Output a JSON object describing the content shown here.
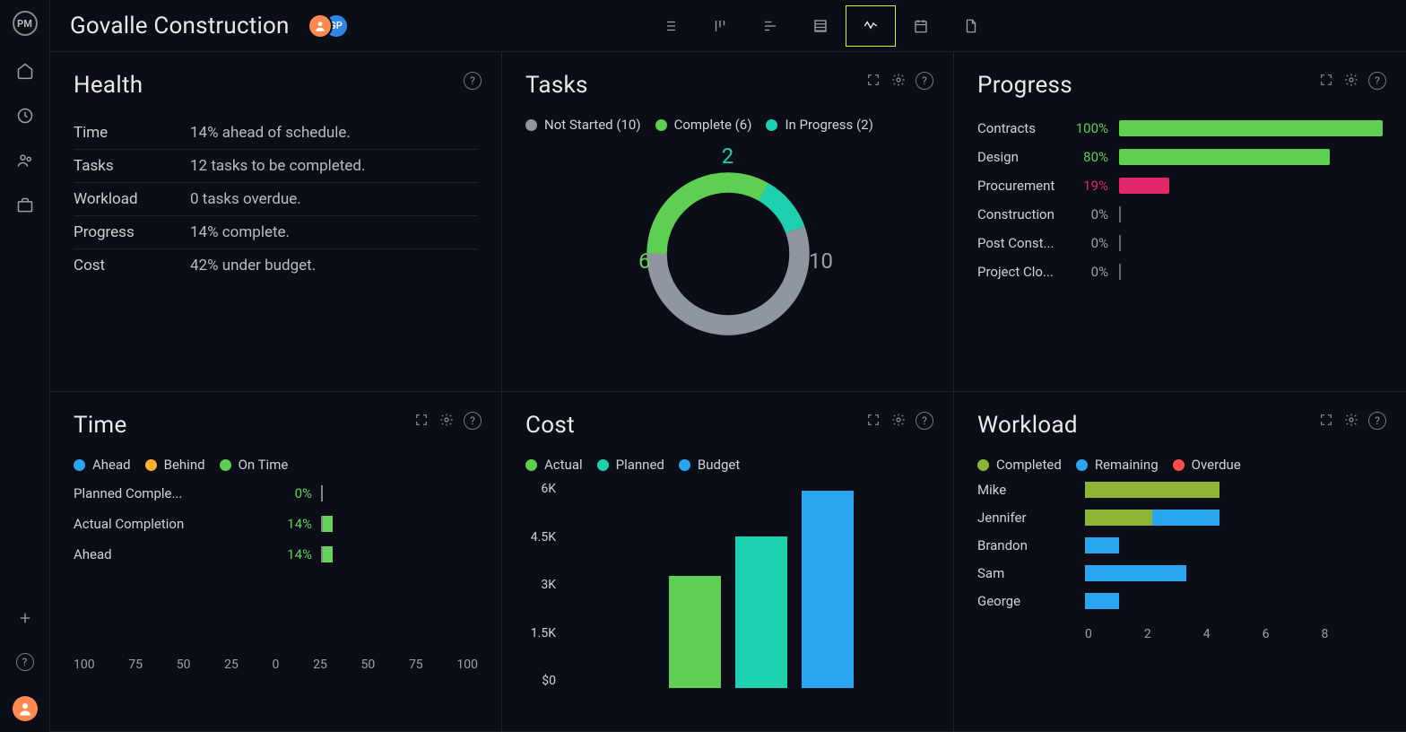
{
  "header": {
    "project_title": "Govalle Construction",
    "badge2_initials": "GP"
  },
  "colors": {
    "green": "#5fcf53",
    "teal": "#1dd1b0",
    "gray": "#8f96a1",
    "blue": "#2aa5ef",
    "olive": "#8db437",
    "pink": "#e2286b",
    "orange": "#ffb02e",
    "red": "#ff4c4c"
  },
  "panels": {
    "health": {
      "title": "Health",
      "rows": [
        {
          "label": "Time",
          "value": "14% ahead of schedule."
        },
        {
          "label": "Tasks",
          "value": "12 tasks to be completed."
        },
        {
          "label": "Workload",
          "value": "0 tasks overdue."
        },
        {
          "label": "Progress",
          "value": "14% complete."
        },
        {
          "label": "Cost",
          "value": "42% under budget."
        }
      ]
    },
    "tasks": {
      "title": "Tasks",
      "legend": [
        {
          "label": "Not Started (10)",
          "color": "#8f96a1",
          "icon": "dot-gray"
        },
        {
          "label": "Complete (6)",
          "color": "#5fcf53",
          "icon": "dot-green"
        },
        {
          "label": "In Progress (2)",
          "color": "#1dd1b0",
          "icon": "dot-teal"
        }
      ],
      "chart_data": {
        "type": "pie",
        "title": "Tasks",
        "categories": [
          "Not Started",
          "Complete",
          "In Progress"
        ],
        "values": [
          10,
          6,
          2
        ],
        "colors": [
          "#8f96a1",
          "#5fcf53",
          "#1dd1b0"
        ]
      },
      "labels": {
        "top": "2",
        "left": "6",
        "right": "10"
      }
    },
    "progress": {
      "title": "Progress",
      "chart_data": {
        "type": "bar",
        "orientation": "horizontal",
        "xlim": [
          0,
          100
        ],
        "categories": [
          "Contracts",
          "Design",
          "Procurement",
          "Construction",
          "Post Const...",
          "Project Clo..."
        ],
        "values": [
          100,
          80,
          19,
          0,
          0,
          0
        ],
        "colors": [
          "#5fcf53",
          "#5fcf53",
          "#e2286b",
          null,
          null,
          null
        ]
      }
    },
    "time": {
      "title": "Time",
      "legend": [
        {
          "label": "Ahead",
          "color": "#2aa5ef"
        },
        {
          "label": "Behind",
          "color": "#ffb02e"
        },
        {
          "label": "On Time",
          "color": "#5fcf53"
        }
      ],
      "chart_data": {
        "type": "bar",
        "orientation": "horizontal",
        "xlim": [
          -100,
          100
        ],
        "xticks": [
          100,
          75,
          50,
          25,
          0,
          25,
          50,
          75,
          100
        ],
        "series": [
          {
            "name": "Planned Comple...",
            "value": 0,
            "display": "0%"
          },
          {
            "name": "Actual Completion",
            "value": 14,
            "display": "14%"
          },
          {
            "name": "Ahead",
            "value": 14,
            "display": "14%"
          }
        ]
      }
    },
    "cost": {
      "title": "Cost",
      "legend": [
        {
          "label": "Actual",
          "color": "#5fcf53"
        },
        {
          "label": "Planned",
          "color": "#1dd1b0"
        },
        {
          "label": "Budget",
          "color": "#2aa5ef"
        }
      ],
      "chart_data": {
        "type": "bar",
        "categories": [
          "Actual",
          "Planned",
          "Budget"
        ],
        "values": [
          3400,
          4600,
          6000
        ],
        "colors": [
          "#5fcf53",
          "#1dd1b0",
          "#2aa5ef"
        ],
        "ylim": [
          0,
          6000
        ],
        "yticks_labels": [
          "6K",
          "4.5K",
          "3K",
          "1.5K",
          "$0"
        ]
      }
    },
    "workload": {
      "title": "Workload",
      "legend": [
        {
          "label": "Completed",
          "color": "#8db437"
        },
        {
          "label": "Remaining",
          "color": "#2aa5ef"
        },
        {
          "label": "Overdue",
          "color": "#ff4c4c"
        }
      ],
      "chart_data": {
        "type": "bar",
        "orientation": "horizontal",
        "xlim": [
          0,
          8
        ],
        "xticks": [
          0,
          2,
          4,
          6,
          8
        ],
        "categories": [
          "Mike",
          "Jennifer",
          "Brandon",
          "Sam",
          "George"
        ],
        "series": [
          {
            "name": "Completed",
            "color": "#8db437",
            "values": [
              4,
              2,
              0,
              0,
              0
            ]
          },
          {
            "name": "Remaining",
            "color": "#2aa5ef",
            "values": [
              0,
              2,
              1,
              3,
              1
            ]
          },
          {
            "name": "Overdue",
            "color": "#ff4c4c",
            "values": [
              0,
              0,
              0,
              0,
              0
            ]
          }
        ]
      }
    }
  }
}
